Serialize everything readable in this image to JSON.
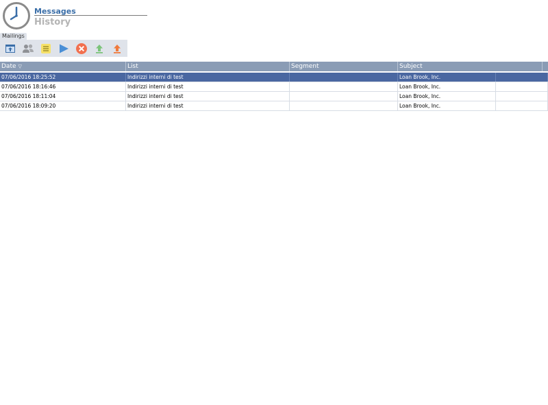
{
  "header": {
    "title": "Messages",
    "subtitle": "History",
    "icon": "clock-icon",
    "accent_color": "#3a6ea8"
  },
  "tabs": [
    {
      "label": "Mailings"
    }
  ],
  "toolbar": {
    "buttons": [
      {
        "icon": "upload-window-icon"
      },
      {
        "icon": "users-icon"
      },
      {
        "icon": "list-icon"
      },
      {
        "icon": "play-icon"
      },
      {
        "icon": "cancel-icon"
      },
      {
        "icon": "arrow-up-green-icon"
      },
      {
        "icon": "arrow-up-orange-icon"
      }
    ]
  },
  "table": {
    "columns": [
      "Date",
      "List",
      "Segment",
      "Subject"
    ],
    "sort_column": "Date",
    "sort_direction": "descending",
    "selected_row": 0,
    "rows": [
      {
        "date": "07/06/2016 18:25:52",
        "list": "Indirizzi interni di test",
        "segment": "",
        "subject": "Loan Brook, Inc."
      },
      {
        "date": "07/06/2016 18:16:46",
        "list": "Indirizzi interni di test",
        "segment": "",
        "subject": "Loan Brook, Inc."
      },
      {
        "date": "07/06/2016 18:11:04",
        "list": "Indirizzi interni di test",
        "segment": "",
        "subject": "Loan Brook, Inc."
      },
      {
        "date": "07/06/2016 18:09:20",
        "list": "Indirizzi interni di test",
        "segment": "",
        "subject": "Loan Brook, Inc."
      }
    ]
  }
}
